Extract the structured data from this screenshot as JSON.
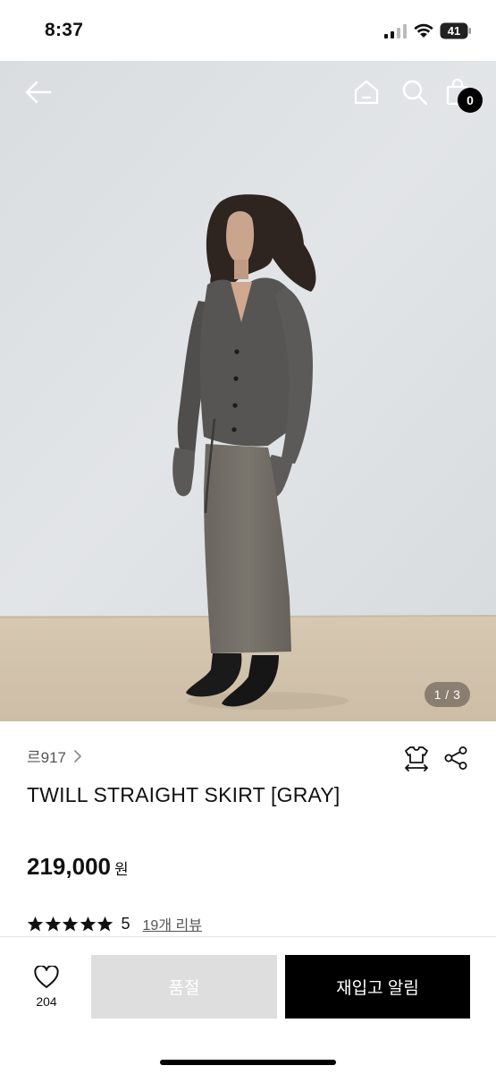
{
  "status_bar": {
    "time": "8:37",
    "battery_level": "41"
  },
  "hero": {
    "image_counter": "1 / 3",
    "cart_count": "0",
    "icons": [
      "back-arrow-icon",
      "home-icon",
      "search-icon",
      "shopping-bag-icon"
    ]
  },
  "product": {
    "brand": "르917",
    "title": "TWILL STRAIGHT SKIRT [GRAY]",
    "price": "219,000",
    "currency": "원",
    "rating_score": "5",
    "stars": 5,
    "review_link": "19개 리뷰"
  },
  "bottom_bar": {
    "like_count": "204",
    "soldout_label": "품절",
    "restock_label": "재입고 알림"
  },
  "colors": {
    "accent": "#000000",
    "soldout_bg": "#dedede",
    "background_wall": "#dfe3e6",
    "floor": "#d3c4ae"
  }
}
